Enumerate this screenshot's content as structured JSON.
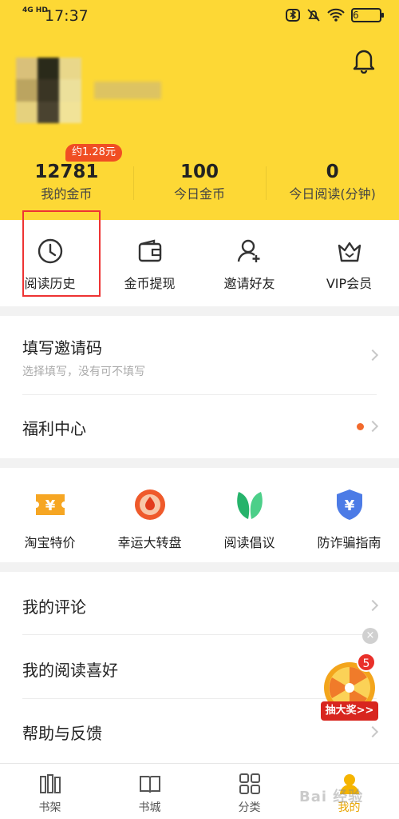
{
  "status_bar": {
    "network": "4G HD",
    "time": "17:37",
    "battery": "6"
  },
  "profile": {
    "coin_badge": "约1.28元"
  },
  "stats": [
    {
      "value": "12781",
      "label": "我的金币"
    },
    {
      "value": "100",
      "label": "今日金币"
    },
    {
      "value": "0",
      "label": "今日阅读(分钟)"
    }
  ],
  "quick_actions": [
    {
      "label": "阅读历史",
      "icon": "clock-icon"
    },
    {
      "label": "金币提现",
      "icon": "wallet-icon"
    },
    {
      "label": "邀请好友",
      "icon": "add-user-icon"
    },
    {
      "label": "VIP会员",
      "icon": "crown-icon"
    }
  ],
  "menu1": {
    "invite_code": {
      "title": "填写邀请码",
      "subtitle": "选择填写，没有可不填写"
    },
    "welfare": {
      "title": "福利中心"
    }
  },
  "features": [
    {
      "label": "淘宝特价",
      "icon": "coupon-icon"
    },
    {
      "label": "幸运大转盘",
      "icon": "wheel-icon"
    },
    {
      "label": "阅读倡议",
      "icon": "leaf-icon"
    },
    {
      "label": "防诈骗指南",
      "icon": "shield-icon"
    }
  ],
  "menu2": {
    "items": [
      {
        "title": "我的评论"
      },
      {
        "title": "我的阅读喜好"
      },
      {
        "title": "帮助与反馈"
      }
    ]
  },
  "lottery": {
    "count": "5",
    "label": "抽大奖>>",
    "close": "×"
  },
  "tabs": [
    {
      "label": "书架",
      "icon": "bookshelf-icon"
    },
    {
      "label": "书城",
      "icon": "book-icon"
    },
    {
      "label": "分类",
      "icon": "grid-icon"
    },
    {
      "label": "我的",
      "icon": "profile-icon",
      "active": true
    }
  ],
  "watermark": "Bai 经验",
  "colors": {
    "header_yellow": "#fdd835",
    "accent_orange": "#f26a2d",
    "badge_red": "#f04e23",
    "active_tab": "#e8a400"
  }
}
